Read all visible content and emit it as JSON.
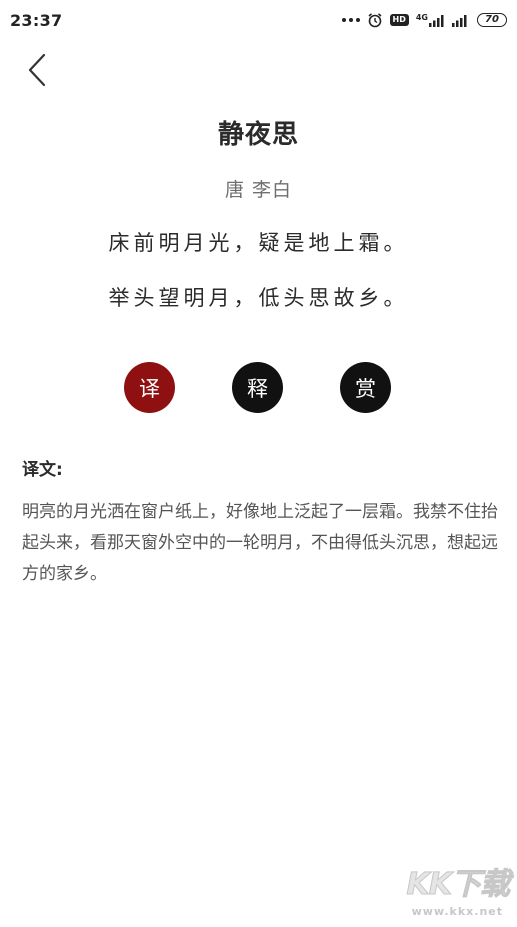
{
  "status_bar": {
    "time": "23:37",
    "battery": "70",
    "hd": "HD",
    "net": "4G"
  },
  "poem": {
    "title": "静夜思",
    "author": "唐 李白",
    "lines": [
      "床前明月光，疑是地上霜。",
      "举头望明月，低头思故乡。"
    ]
  },
  "actions": [
    {
      "label": "译",
      "active": true
    },
    {
      "label": "释",
      "active": false
    },
    {
      "label": "赏",
      "active": false
    }
  ],
  "translation": {
    "heading": "译文:",
    "body": "明亮的月光洒在窗户纸上，好像地上泛起了一层霜。我禁不住抬起头来，看那天窗外空中的一轮明月，不由得低头沉思，想起远方的家乡。"
  },
  "watermark": {
    "brand": "KK下载",
    "url": "www.kkx.net"
  },
  "colors": {
    "active_button": "#8f1010",
    "button": "#111111",
    "text": "#2b2b2b",
    "muted_text": "#6f6f6f"
  }
}
